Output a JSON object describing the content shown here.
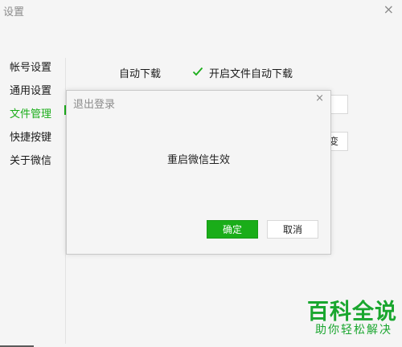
{
  "window": {
    "title": "设置",
    "close_glyph": "×"
  },
  "sidebar": {
    "items": [
      {
        "label": "帐号设置"
      },
      {
        "label": "通用设置"
      },
      {
        "label": "文件管理"
      },
      {
        "label": "快捷按键"
      },
      {
        "label": "关于微信"
      }
    ],
    "active_index": 2
  },
  "settings": {
    "auto_download_label": "自动下载",
    "auto_download_option": "开启文件自动下载",
    "auto_download_checked": true,
    "ghost_button_text": "变"
  },
  "dialog": {
    "title": "退出登录",
    "message": "重启微信生效",
    "confirm_label": "确定",
    "cancel_label": "取消",
    "close_glyph": "×"
  },
  "watermark": {
    "title": "百科全说",
    "subtitle": "助你轻松解决"
  },
  "colors": {
    "accent": "#1aad19",
    "watermark": "#19a62e"
  }
}
